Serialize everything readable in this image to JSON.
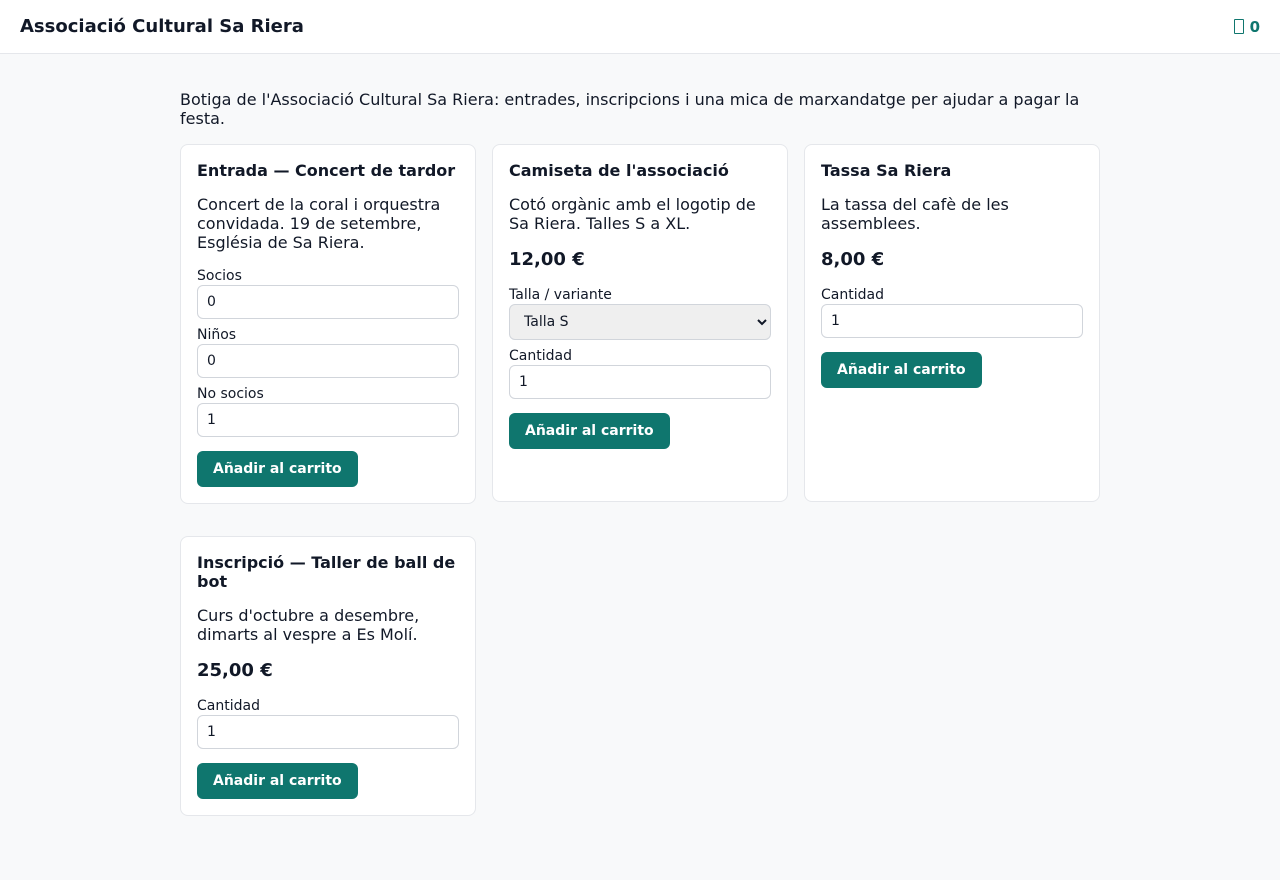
{
  "header": {
    "title": "Associació Cultural Sa Riera",
    "cart_count": "0"
  },
  "intro": "Botiga de l'Associació Cultural Sa Riera: entrades, inscripcions i una mica de marxandatge per ajudar a pagar la festa.",
  "products": [
    {
      "title": "Entrada — Concert de tardor",
      "description": "Concert de la coral i orquestra convidada. 19 de setembre, Església de Sa Riera.",
      "fields": [
        {
          "label": "Socios",
          "value": "0"
        },
        {
          "label": "Niños",
          "value": "0"
        },
        {
          "label": "No socios",
          "value": "1"
        }
      ],
      "button": "Añadir al carrito"
    },
    {
      "title": "Camiseta de l'associació",
      "description": "Cotó orgànic amb el logotip de Sa Riera. Talles S a XL.",
      "price": "12,00 €",
      "variant_label": "Talla / variante",
      "variant_value": "Talla S",
      "quantity_label": "Cantidad",
      "quantity_value": "1",
      "button": "Añadir al carrito"
    },
    {
      "title": "Tassa Sa Riera",
      "description": "La tassa del cafè de les assemblees.",
      "price": "8,00 €",
      "quantity_label": "Cantidad",
      "quantity_value": "1",
      "button": "Añadir al carrito"
    },
    {
      "title": "Inscripció — Taller de ball de bot",
      "description": "Curs d'octubre a desembre, dimarts al vespre a Es Molí.",
      "price": "25,00 €",
      "quantity_label": "Cantidad",
      "quantity_value": "1",
      "button": "Añadir al carrito"
    }
  ],
  "icons": {
    "cart": "shopping-cart-icon"
  },
  "colors": {
    "accent": "#0f766e",
    "background": "#f8f9fa"
  }
}
